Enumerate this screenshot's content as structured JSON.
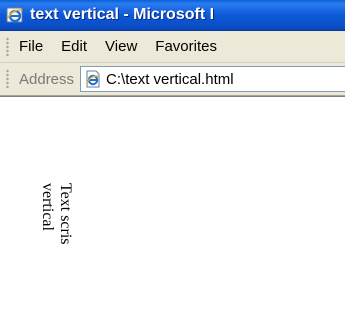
{
  "window": {
    "title": "text vertical - Microsoft I"
  },
  "menu": {
    "items": [
      "File",
      "Edit",
      "View",
      "Favorites"
    ]
  },
  "address_bar": {
    "label": "Address",
    "value": "C:\\text vertical.html"
  },
  "content": {
    "line1": "Text scris",
    "line2": "vertical"
  },
  "colors": {
    "titlebar": "#0c59d8",
    "toolbar": "#ece9d8"
  },
  "icons": {
    "title": "ie-logo-icon",
    "page": "ie-page-icon"
  }
}
